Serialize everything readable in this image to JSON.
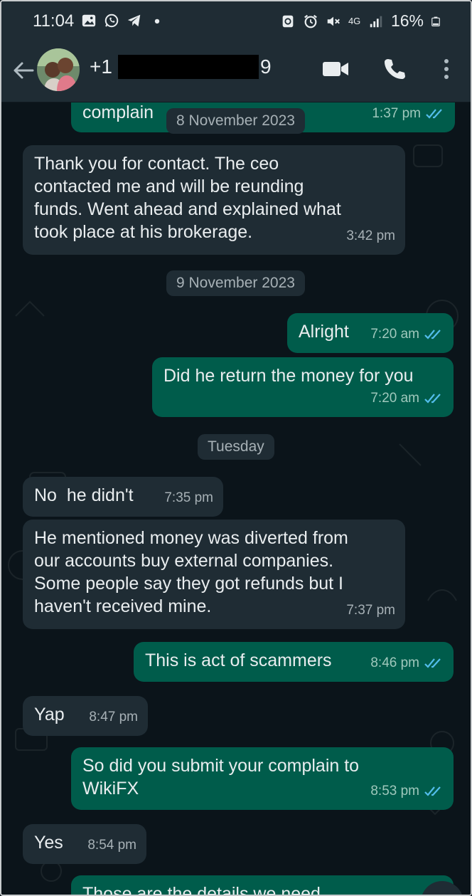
{
  "status_bar": {
    "time": "11:04",
    "network": "4G",
    "battery": "16%"
  },
  "header": {
    "contact_prefix": "+1",
    "contact_suffix": "9"
  },
  "messages": {
    "m0": {
      "text": "complain",
      "time": "1:37 pm"
    },
    "date1": "8 November 2023",
    "m1": {
      "text": "Thank you for contact. The ceo\ncontacted me and will be reunding\nfunds. Went ahead and explained what\ntook place at his brokerage.",
      "time": "3:42 pm"
    },
    "date2": "9 November 2023",
    "m2": {
      "text": "Alright",
      "time": "7:20 am"
    },
    "m3": {
      "text": "Did he return the money for you",
      "time": "7:20 am"
    },
    "date3": "Tuesday",
    "m4": {
      "text": "No  he didn't",
      "time": "7:35 pm"
    },
    "m5": {
      "text": "He mentioned money was diverted from\nour accounts buy external companies.\nSome people say they got refunds but I\nhaven't received mine.",
      "time": "7:37 pm"
    },
    "m6": {
      "text": "This is act of scammers",
      "time": "8:46 pm"
    },
    "m7": {
      "text": "Yap",
      "time": "8:47 pm"
    },
    "m8": {
      "text": "So did you submit your complain to\nWikiFX",
      "time": "8:53 pm"
    },
    "m9": {
      "text": "Yes",
      "time": "8:54 pm"
    },
    "m10": {
      "text": "Those are the details we need"
    }
  },
  "colors": {
    "background": "#0b141a",
    "incoming_bubble": "#1f2c34",
    "outgoing_bubble": "#005c4b",
    "read_ticks": "#53bdeb"
  }
}
